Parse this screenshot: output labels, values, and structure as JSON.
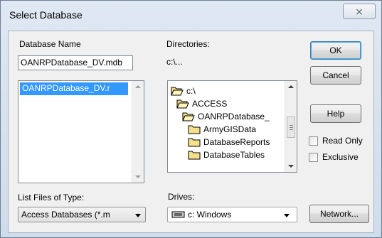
{
  "window": {
    "title": "Select Database",
    "close_glyph": "⨯"
  },
  "database_name": {
    "label": "Database Name",
    "value": "OANRPDatabase_DV.mdb",
    "list_selected": "OANRPDatabase_DV.r"
  },
  "directories": {
    "label": "Directories:",
    "path": "c:\\...",
    "items": [
      {
        "label": "c:\\",
        "icon": "open-folder-icon"
      },
      {
        "label": "ACCESS",
        "icon": "open-folder-icon"
      },
      {
        "label": "OANRPDatabase_",
        "icon": "open-folder-icon"
      },
      {
        "label": "ArmyGISData",
        "icon": "folder-icon"
      },
      {
        "label": "DatabaseReports",
        "icon": "folder-icon"
      },
      {
        "label": "DatabaseTables",
        "icon": "folder-icon"
      }
    ]
  },
  "file_type": {
    "label": "List Files of Type:",
    "value": "Access Databases (*.m"
  },
  "drives": {
    "label": "Drives:",
    "value": "c: Windows"
  },
  "buttons": {
    "ok": "OK",
    "cancel": "Cancel",
    "help": "Help",
    "network": "Network..."
  },
  "options": {
    "read_only": "Read Only",
    "exclusive": "Exclusive"
  }
}
